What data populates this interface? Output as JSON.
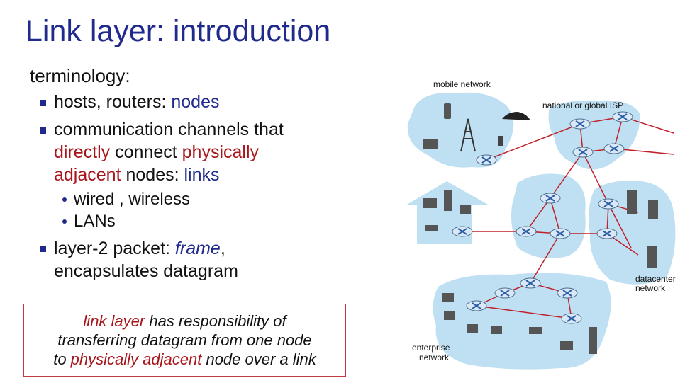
{
  "slide": {
    "title": "Link layer: introduction",
    "subtitle": "terminology:",
    "bullet1": {
      "plain": "hosts, routers: ",
      "blue": "nodes"
    },
    "bullet2": {
      "line1": "communication channels that",
      "red1": "directly",
      "mid1": " connect ",
      "red2": "physically",
      "red3": "adjacent",
      "mid2": " nodes: ",
      "blue": "links"
    },
    "sub1": "wired , wireless",
    "sub2": "LANs",
    "bullet3": {
      "plain": "layer-2 packet: ",
      "italic_blue": "frame",
      "tail": ",",
      "line2": "encapsulates datagram"
    },
    "callout": {
      "red1": "link layer",
      "text1": " has responsibility of",
      "line2": "transferring datagram from one node",
      "to": "to ",
      "red2": "physically adjacent",
      "text3": " node over a link"
    }
  },
  "diagram": {
    "labels": {
      "mobile": "mobile network",
      "isp": "national or global ISP",
      "datacenter1": "datacenter",
      "datacenter2": "network",
      "enterprise1": "enterprise",
      "enterprise2": "network"
    },
    "colors": {
      "cloud": "#bfe0f2",
      "router": "#d9e8f4",
      "router_x": "#2a5ea8",
      "link": "#c0202a",
      "host": "#555555"
    }
  }
}
